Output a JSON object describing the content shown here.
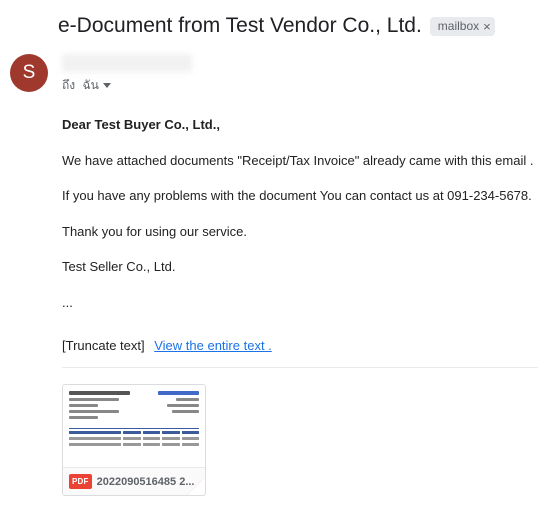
{
  "header": {
    "subject": "e-Document from Test Vendor Co., Ltd.",
    "label": "mailbox"
  },
  "avatar": {
    "initial": "S"
  },
  "to_line": {
    "prefix": "ถึง",
    "recipient": "ฉัน"
  },
  "body": {
    "greeting": "Dear Test Buyer Co., Ltd.,",
    "p1": "We have attached documents \"Receipt/Tax Invoice\" already came with this email .",
    "p2": "If you have any problems with the document You can contact us at 091-234-5678.",
    "p3": "Thank you for using our service.",
    "p4": "Test Seller Co., Ltd.",
    "ellipsis": "..."
  },
  "truncate": {
    "label": "[Truncate text]",
    "link": "View the entire text ."
  },
  "attachment": {
    "badge": "PDF",
    "filename": "2022090516485 2..."
  }
}
